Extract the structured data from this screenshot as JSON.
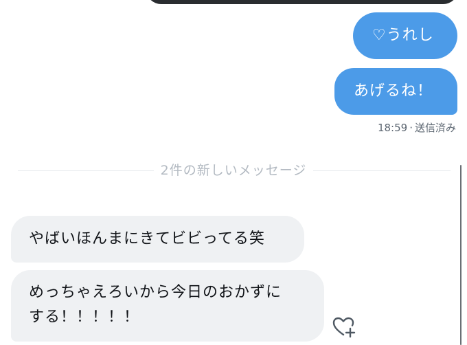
{
  "conversation": {
    "messages": [
      {
        "type": "image",
        "direction": "sent"
      },
      {
        "direction": "sent",
        "text": "♡うれし"
      },
      {
        "direction": "sent",
        "text": "あげるね！"
      },
      {
        "direction": "received",
        "text": "やばいほんまにきてビビってる笑"
      },
      {
        "direction": "received",
        "text_line1": "めっちゃえろいから今日のおかずに",
        "text_line2": "する！！！！！"
      }
    ],
    "status": {
      "time": "18:59",
      "separator": "·",
      "state": "送信済み"
    },
    "divider_label": "2件の新しいメッセージ",
    "reaction_icon": "heart-add-icon"
  },
  "colors": {
    "sent_bubble": "#4c9be8",
    "received_bubble": "#eff1f3",
    "status_text": "#5b6570",
    "divider_text": "#b3bac2"
  }
}
